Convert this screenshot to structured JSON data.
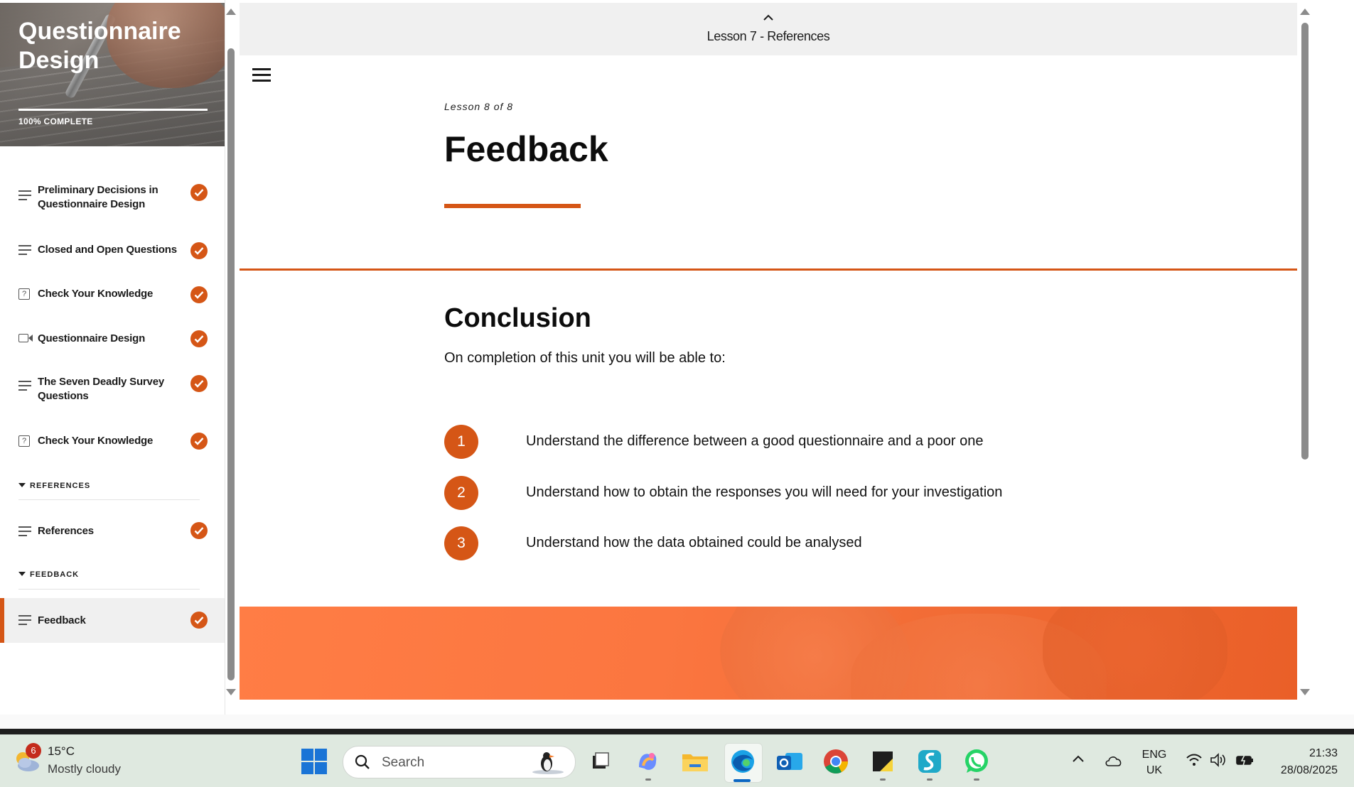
{
  "sidebar": {
    "course_title": "Questionnaire Design",
    "progress_label": "100% COMPLETE",
    "progress_percent": 100,
    "items": [
      {
        "label": "Preliminary Decisions in Questionnaire Design",
        "icon": "text-lines-icon",
        "completed": true
      },
      {
        "label": "Closed and Open Questions",
        "icon": "text-lines-icon",
        "completed": true
      },
      {
        "label": "Check Your Knowledge",
        "icon": "quiz-icon",
        "completed": true
      },
      {
        "label": "Questionnaire Design",
        "icon": "video-icon",
        "completed": true
      },
      {
        "label": "The Seven Deadly Survey Questions",
        "icon": "text-lines-icon",
        "completed": true
      },
      {
        "label": "Check Your Knowledge",
        "icon": "quiz-icon",
        "completed": true
      }
    ],
    "sections": [
      {
        "heading": "REFERENCES",
        "items": [
          {
            "label": "References",
            "icon": "text-lines-icon",
            "completed": true
          }
        ]
      },
      {
        "heading": "FEEDBACK",
        "items": [
          {
            "label": "Feedback",
            "icon": "text-lines-icon",
            "completed": true,
            "active": true
          }
        ]
      }
    ]
  },
  "topbar": {
    "previous_lesson": "Lesson 7 - References"
  },
  "lesson": {
    "count": "Lesson 8 of 8",
    "title": "Feedback",
    "section_heading": "Conclusion",
    "intro": "On completion of this unit you will be able to:",
    "objectives": [
      {
        "number": "1",
        "text": "Understand the difference between a good questionnaire and a poor one"
      },
      {
        "number": "2",
        "text": "Understand how to obtain the responses you will need for your investigation"
      },
      {
        "number": "3",
        "text": "Understand how the data obtained could be analysed"
      }
    ]
  },
  "taskbar": {
    "weather": {
      "badge": "6",
      "temperature": "15°C",
      "condition": "Mostly cloudy"
    },
    "search_placeholder": "Search",
    "language": {
      "line1": "ENG",
      "line2": "UK"
    },
    "time": "21:33",
    "date": "28/08/2025"
  },
  "colors": {
    "accent": "#d55616",
    "banner": "#f56f37",
    "topbar": "#f0f0f0",
    "taskbar": "#dfe9e0"
  }
}
